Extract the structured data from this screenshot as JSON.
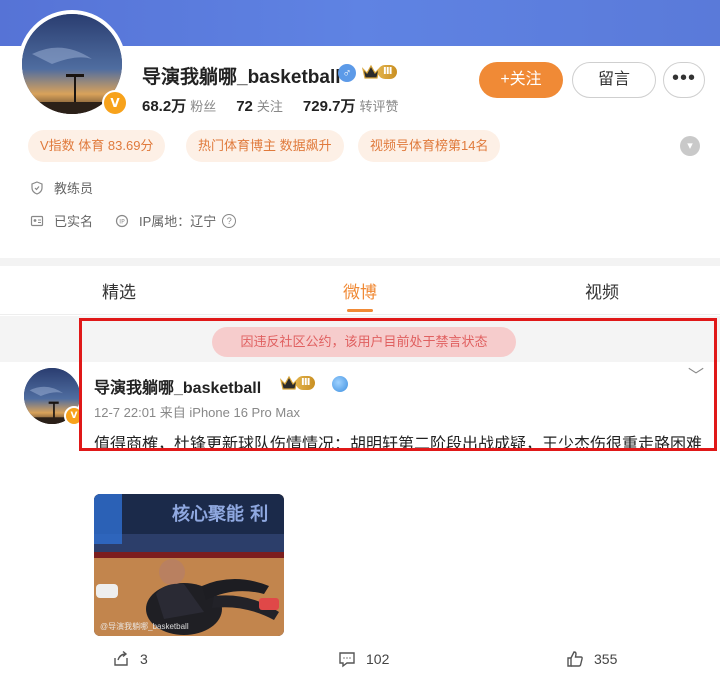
{
  "profile": {
    "name": "导演我躺哪_basketball",
    "level_badge": "Ⅲ",
    "verified_mark": "V",
    "stats": [
      {
        "value": "68.2万",
        "label": "粉丝"
      },
      {
        "value": "72",
        "label": "关注"
      },
      {
        "value": "729.7万",
        "label": "转评赞"
      }
    ],
    "follow_label": "+关注",
    "message_label": "留言",
    "more_label": "•••",
    "tags": [
      "V指数 体育 83.69分",
      "热门体育博主 数据飙升",
      "视频号体育榜第14名"
    ],
    "info": {
      "occupation": "教练员",
      "realname": "已实名",
      "ip_location": "IP属地：辽宁"
    }
  },
  "tabs": [
    "精选",
    "微博",
    "视频"
  ],
  "active_tab": "微博",
  "notice": "因违反社区公约，该用户目前处于禁言状态",
  "post": {
    "author": "导演我躺哪_basketball",
    "level_badge": "Ⅲ",
    "meta": "12-7 22:01  来自 iPhone 16 Pro Max",
    "text": "值得商榷，杜锋更新球队伤情情况：胡明轩第二阶段出战成疑，王少杰伤很重走路困难",
    "image_banner_text": "核心聚能 利",
    "image_watermark": "@导演我躺哪_basketball",
    "actions": {
      "repost": "3",
      "comments": "102",
      "likes": "355"
    }
  },
  "colors": {
    "accent": "#f08a36",
    "banner": "#5a7ad9",
    "frame": "#e01818",
    "notice_bg": "#f6cccc"
  }
}
